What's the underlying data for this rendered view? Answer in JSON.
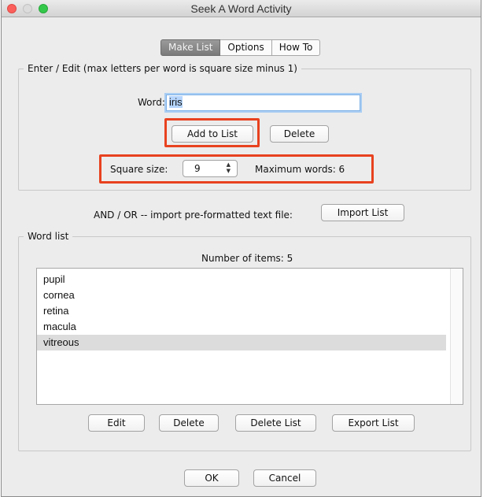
{
  "window": {
    "title": "Seek A Word Activity"
  },
  "tabs": [
    {
      "label": "Make List",
      "active": true
    },
    {
      "label": "Options",
      "active": false
    },
    {
      "label": "How To",
      "active": false
    }
  ],
  "entry_group": {
    "legend": "Enter / Edit (max letters per word is square size minus 1)",
    "word_label": "Word:",
    "word_value": "iris",
    "add_button": "Add to List",
    "delete_button": "Delete",
    "square_size_label": "Square size:",
    "square_size_value": "9",
    "max_words_text": "Maximum words: 6"
  },
  "import": {
    "label": "AND / OR -- import pre-formatted text file:",
    "button": "Import List"
  },
  "word_list_group": {
    "legend": "Word list",
    "count_text": "Number of items: 5",
    "items": [
      {
        "text": "pupil",
        "selected": false
      },
      {
        "text": "cornea",
        "selected": false
      },
      {
        "text": "retina",
        "selected": false
      },
      {
        "text": "macula",
        "selected": false
      },
      {
        "text": "vitreous",
        "selected": true
      }
    ],
    "buttons": {
      "edit": "Edit",
      "delete": "Delete",
      "delete_list": "Delete List",
      "export_list": "Export List"
    }
  },
  "footer": {
    "ok": "OK",
    "cancel": "Cancel"
  },
  "colors": {
    "highlight": "#e8421f",
    "selection": "#dcdcdc",
    "active_tab": "#7a7a7a"
  }
}
